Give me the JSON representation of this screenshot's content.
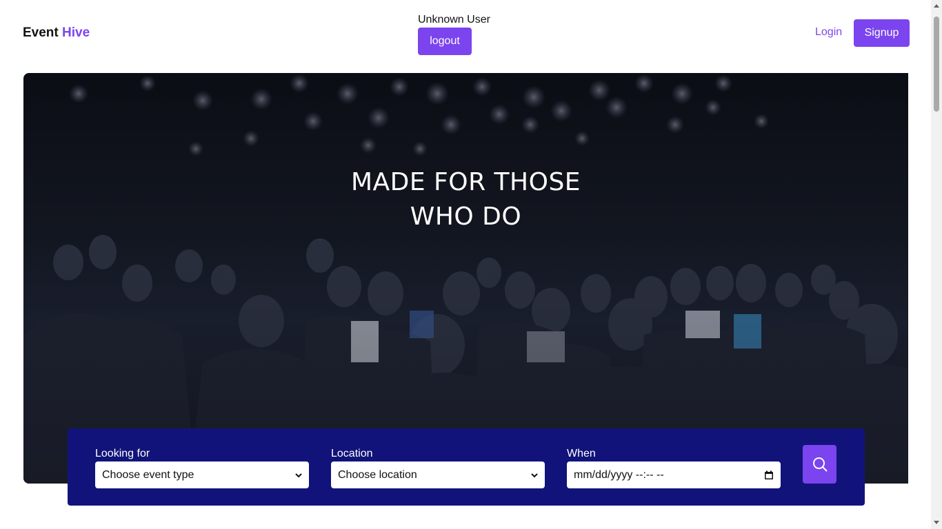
{
  "header": {
    "brand_main": "Event",
    "brand_accent": "Hive",
    "user_name": "Unknown User",
    "logout_label": "logout",
    "login_label": "Login",
    "signup_label": "Signup"
  },
  "hero": {
    "title_line1": "MADE FOR THOSE",
    "title_line2": "WHO DO"
  },
  "search": {
    "looking_for_label": "Looking for",
    "looking_for_value": "Choose event type",
    "location_label": "Location",
    "location_value": "Choose location",
    "when_label": "When",
    "when_value": "mm/dd/yyyy --:-- --"
  },
  "colors": {
    "accent": "#7b44ef",
    "search_panel": "#11137a"
  }
}
